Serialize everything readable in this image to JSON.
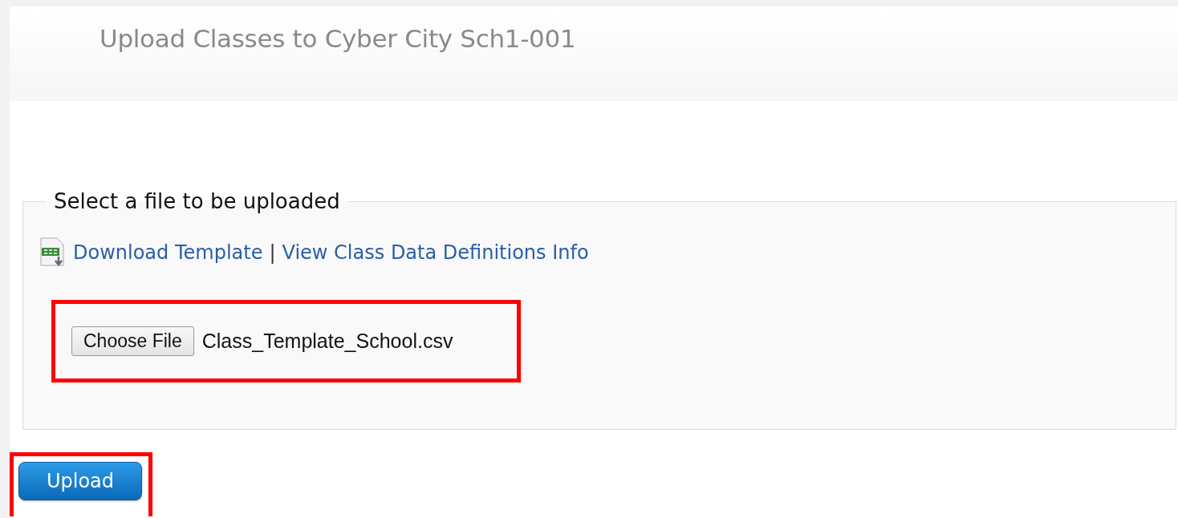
{
  "header": {
    "title": "Upload Classes to Cyber City Sch1-001"
  },
  "upload_form": {
    "legend": "Select a file to be uploaded",
    "links": [
      {
        "label": "Download Template",
        "kind": "file"
      },
      {
        "label": "View Class Data Definitions Info",
        "kind": "plain"
      }
    ],
    "separator": "|",
    "file_input": {
      "button": "Choose File",
      "value": "Class_Template_School.csv",
      "highlighted": true
    }
  },
  "upload_button": {
    "label": "Upload",
    "highlighted": true
  }
}
